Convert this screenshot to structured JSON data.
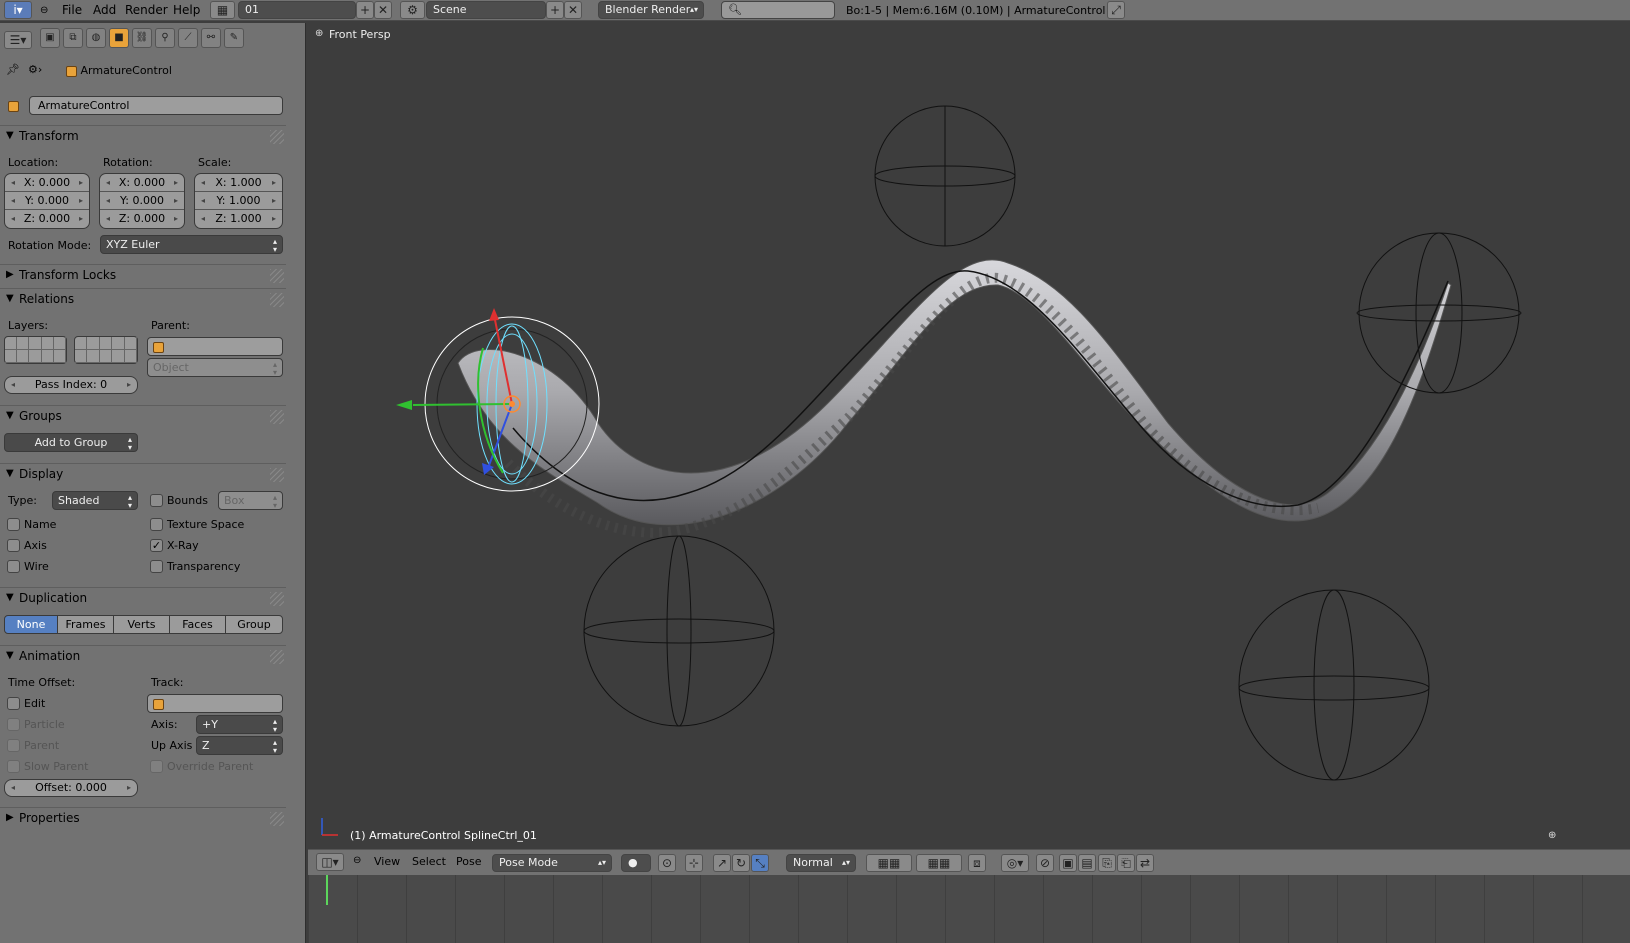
{
  "topbar": {
    "menu": [
      "File",
      "Add",
      "Render",
      "Help"
    ],
    "screen_layout": "01",
    "scene": "Scene",
    "engine": "Blender Render",
    "stats": "Bo:1-5  | Mem:6.16M (0.10M) | ArmatureControl"
  },
  "props": {
    "breadcrumb": "ArmatureControl",
    "object_name": "ArmatureControl",
    "transform": {
      "title": "Transform",
      "location_label": "Location:",
      "rotation_label": "Rotation:",
      "scale_label": "Scale:",
      "location": [
        "X: 0.000",
        "Y: 0.000",
        "Z: 0.000"
      ],
      "rotation": [
        "X: 0.000",
        "Y: 0.000",
        "Z: 0.000"
      ],
      "scale": [
        "X: 1.000",
        "Y: 1.000",
        "Z: 1.000"
      ],
      "rotation_mode_label": "Rotation Mode:",
      "rotation_mode": "XYZ Euler"
    },
    "transform_locks": "Transform Locks",
    "relations": {
      "title": "Relations",
      "layers_label": "Layers:",
      "parent_label": "Parent:",
      "parent_type": "Object",
      "pass_index": "Pass Index: 0"
    },
    "groups": {
      "title": "Groups",
      "add_to_group": "Add to Group"
    },
    "display": {
      "title": "Display",
      "type_label": "Type:",
      "type": "Shaded",
      "bounds": "Bounds",
      "bounds_type": "Box",
      "name": "Name",
      "texture_space": "Texture Space",
      "axis": "Axis",
      "xray": "X-Ray",
      "wire": "Wire",
      "transparency": "Transparency",
      "xray_checked": true
    },
    "duplication": {
      "title": "Duplication",
      "options": [
        "None",
        "Frames",
        "Verts",
        "Faces",
        "Group"
      ],
      "active": "None"
    },
    "animation": {
      "title": "Animation",
      "time_offset_label": "Time Offset:",
      "track_label": "Track:",
      "edit": "Edit",
      "particle": "Particle",
      "parent": "Parent",
      "slow_parent": "Slow Parent",
      "axis_label": "Axis:",
      "axis": "+Y",
      "up_axis_label": "Up Axis",
      "up_axis": "Z",
      "override_parent": "Override Parent",
      "offset": "Offset: 0.000"
    },
    "properties": "Properties"
  },
  "viewport": {
    "view_name": "Front Persp",
    "object_info": "(1) ArmatureControl SplineCtrl_01"
  },
  "vheader": {
    "menus": [
      "View",
      "Select",
      "Pose"
    ],
    "mode": "Pose Mode",
    "orientation": "Normal"
  }
}
